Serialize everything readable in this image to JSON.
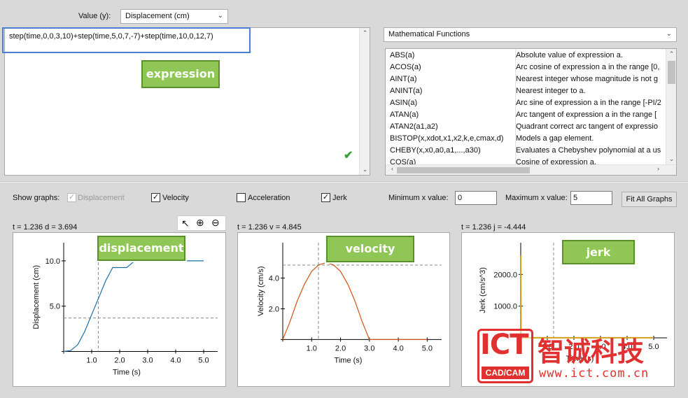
{
  "value_selector": {
    "label": "Value (y):",
    "selected": "Displacement (cm)"
  },
  "expression": {
    "text": "step(time,0,0,3,10)+step(time,5,0,7,-7)+step(time,10,0,12,7)"
  },
  "functions_selector": {
    "selected": "Mathematical Functions"
  },
  "functions": [
    {
      "name": "ABS(a)",
      "desc": "Absolute value of expression a."
    },
    {
      "name": "ACOS(a)",
      "desc": "Arc cosine of expression a in the range [0,"
    },
    {
      "name": "AINT(a)",
      "desc": "Nearest integer whose magnitude is not g"
    },
    {
      "name": "ANINT(a)",
      "desc": "Nearest integer to a."
    },
    {
      "name": "ASIN(a)",
      "desc": "Arc sine of expression a in the range [-PI/2"
    },
    {
      "name": "ATAN(a)",
      "desc": "Arc tangent of expression a in the range ["
    },
    {
      "name": "ATAN2(a1,a2)",
      "desc": "Quadrant correct arc tangent of expressio"
    },
    {
      "name": "BISTOP(x,xdot,x1,x2,k,e,cmax,d)",
      "desc": "Models a gap element."
    },
    {
      "name": "CHEBY(x,x0,a0,a1,...,a30)",
      "desc": "Evaluates a Chebyshev polynomial at a us"
    },
    {
      "name": "COS(a)",
      "desc": "Cosine of expression a."
    }
  ],
  "show_graphs": {
    "label": "Show graphs:",
    "displacement": {
      "label": "Displacement",
      "checked": true
    },
    "velocity": {
      "label": "Velocity",
      "checked": true
    },
    "acceleration": {
      "label": "Acceleration",
      "checked": false
    },
    "jerk": {
      "label": "Jerk",
      "checked": true
    }
  },
  "range": {
    "min_label": "Minimum x value:",
    "min_value": "0",
    "max_label": "Maximum x value:",
    "max_value": "5",
    "fit_button": "Fit All Graphs"
  },
  "callouts": {
    "expression": "expression",
    "displacement": "displacement",
    "velocity": "velocity",
    "jerk": "jerk"
  },
  "readouts": {
    "displacement": "t = 1.236   d = 3.694",
    "velocity": "t = 1.236   v = 4.845",
    "jerk": "t = 1.236   j = -4.444"
  },
  "watermark": {
    "brand": "ICT",
    "cn": "智诚科技",
    "sub": "CAD/CAM",
    "url": "www.ict.com.cn"
  },
  "colors": {
    "callout_fill": "#8fc655",
    "callout_border": "#5a8f29",
    "highlight_box": "#4a7fd4",
    "check_green": "#3aa03a",
    "disp_curve": "#1a6fa0",
    "vel_curve": "#d0541a",
    "jerk_curve": "#d4a017",
    "watermark_red": "#e03030"
  },
  "chart_data": [
    {
      "type": "line",
      "title": "",
      "xlabel": "Time (s)",
      "ylabel": "Displacement (cm)",
      "xlim": [
        0,
        5.5
      ],
      "ylim": [
        -0.5,
        12
      ],
      "xticks": [
        "1.0",
        "2.0",
        "3.0",
        "4.0",
        "5.0"
      ],
      "yticks": [
        "5.0",
        "10.0"
      ],
      "crosshair": {
        "x": 1.236,
        "y": 3.694
      },
      "series": [
        {
          "x": [
            0,
            0.25,
            0.5,
            0.75,
            1.0,
            1.25,
            1.5,
            1.75,
            2.0,
            2.25,
            2.5,
            2.75,
            3.0,
            3.5,
            4.0,
            4.5,
            5.0
          ],
          "values": [
            0,
            0.1,
            0.74,
            2.2,
            4.07,
            5.93,
            7.8,
            9.26,
            9.26,
            9.26,
            9.9,
            9.99,
            10,
            10,
            10,
            10,
            10
          ]
        }
      ]
    },
    {
      "type": "line",
      "title": "",
      "xlabel": "Time (s)",
      "ylabel": "Velocity (cm/s)",
      "xlim": [
        0,
        5.5
      ],
      "ylim": [
        -0.3,
        6.3
      ],
      "xticks": [
        "1.0",
        "2.0",
        "3.0",
        "4.0",
        "5.0"
      ],
      "yticks": [
        "2.0",
        "4.0"
      ],
      "crosshair": {
        "x": 1.236,
        "y": 4.845
      },
      "series": [
        {
          "x": [
            0,
            0.25,
            0.5,
            0.75,
            1.0,
            1.25,
            1.5,
            1.75,
            2.0,
            2.25,
            2.5,
            2.75,
            3.0,
            3.5,
            4.0,
            4.5,
            5.0
          ],
          "values": [
            0,
            1.15,
            2.5,
            3.6,
            4.44,
            4.86,
            5.0,
            4.86,
            4.44,
            3.6,
            2.5,
            1.15,
            0,
            0,
            0,
            0,
            0
          ]
        }
      ]
    },
    {
      "type": "line",
      "title": "",
      "xlabel": "Time (s)",
      "ylabel": "Jerk (cm/s^3)",
      "xlim": [
        0,
        5.5
      ],
      "ylim": [
        -200,
        3000
      ],
      "xticks": [
        "1.0",
        "2.0",
        "3.0",
        "4.0",
        "5.0"
      ],
      "yticks": [
        "1000.0",
        "2000.0"
      ],
      "crosshair": {
        "x": 1.236,
        "y": -4.444
      },
      "series": [
        {
          "x": [
            0,
            0.001,
            0.01,
            3.0,
            5.0
          ],
          "values": [
            0,
            2600,
            0,
            0,
            0
          ]
        }
      ]
    }
  ]
}
